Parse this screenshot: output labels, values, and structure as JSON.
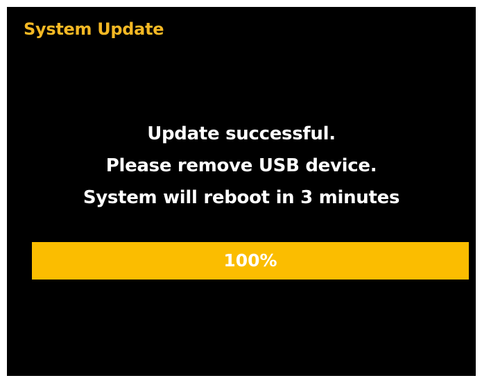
{
  "window": {
    "title": "System Update"
  },
  "message": {
    "line1": "Update successful.",
    "line2": "Please remove USB device.",
    "line3": "System will reboot in 3 minutes"
  },
  "progress": {
    "label": "100%",
    "value": 1.0
  },
  "colors": {
    "background": "#000000",
    "title": "#f4b824",
    "accent": "#fbbd00",
    "text": "#ffffff"
  }
}
